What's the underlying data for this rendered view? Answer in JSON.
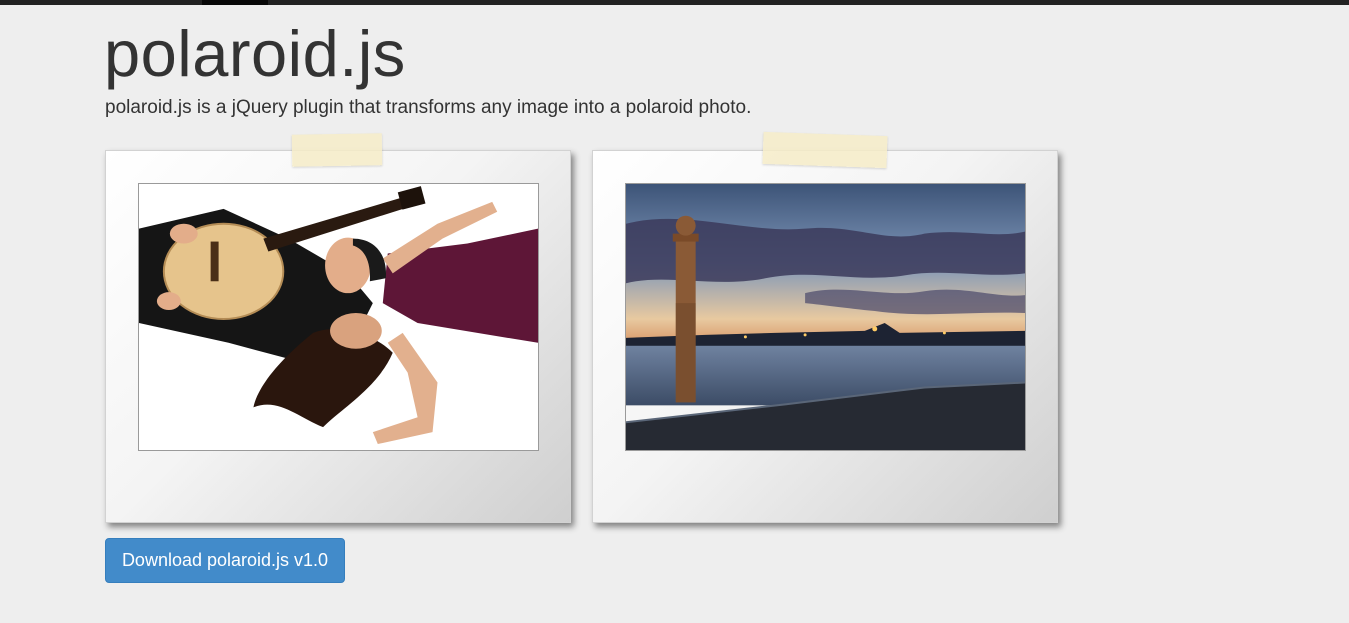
{
  "header": {
    "title": "polaroid.js",
    "lead": "polaroid.js is a jQuery plugin that transforms any image into a polaroid photo."
  },
  "gallery": {
    "photos": [
      {
        "subject": "couple-with-guitar-photo"
      },
      {
        "subject": "harbor-column-sunset-photo"
      }
    ]
  },
  "actions": {
    "download_label": "Download polaroid.js v1.0"
  },
  "colors": {
    "primary": "#428bca",
    "background": "#eeeeee",
    "topbar": "#222222",
    "tape": "#f6ecc8"
  }
}
